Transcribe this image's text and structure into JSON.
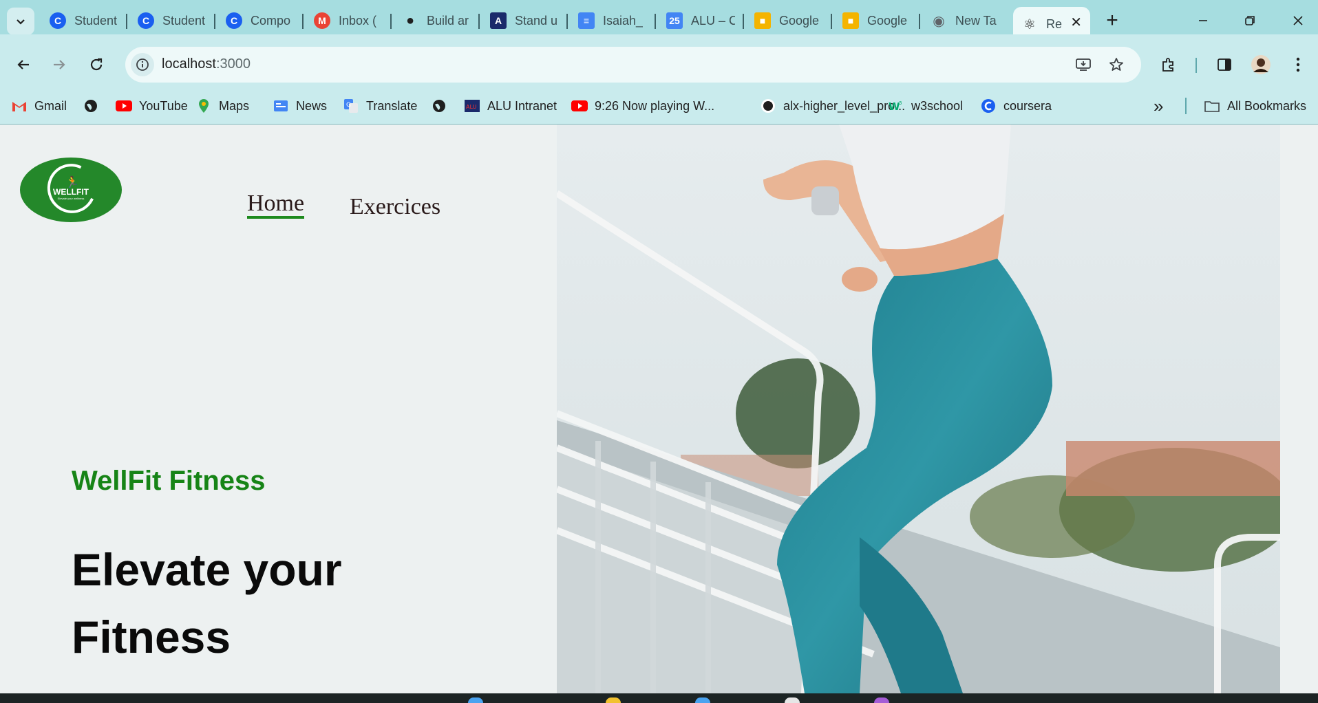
{
  "browser": {
    "tabs": [
      {
        "title": "Student",
        "icon": "c-logo-icon",
        "color": "#1a5ff0"
      },
      {
        "title": "Student",
        "icon": "c-logo-icon",
        "color": "#1a5ff0"
      },
      {
        "title": "Compo",
        "icon": "c-logo-icon",
        "color": "#1a5ff0"
      },
      {
        "title": "Inbox (",
        "icon": "gmail-icon",
        "color": "#ea4335"
      },
      {
        "title": "Build ar",
        "icon": "github-icon",
        "color": "#1f1f1f"
      },
      {
        "title": "Stand u",
        "icon": "alu-icon",
        "color": "#1b2a6b"
      },
      {
        "title": "Isaiah_",
        "icon": "docs-icon",
        "color": "#4285f4"
      },
      {
        "title": "ALU – C",
        "icon": "calendar-icon",
        "color": "#4285f4"
      },
      {
        "title": "Google",
        "icon": "slides-icon",
        "color": "#f4b400"
      },
      {
        "title": "Google",
        "icon": "slides-icon",
        "color": "#f4b400"
      },
      {
        "title": "New Ta",
        "icon": "chrome-icon",
        "color": "#5f6368"
      },
      {
        "title": "Re",
        "icon": "react-icon",
        "color": "#222222",
        "active": true
      }
    ],
    "new_tab_label": "+",
    "url": {
      "host": "localhost",
      "port": ":3000"
    },
    "bookmarks": [
      {
        "label": "Gmail",
        "icon": "gmail-icon"
      },
      {
        "label": "",
        "icon": "globe-icon"
      },
      {
        "label": "YouTube",
        "icon": "youtube-icon"
      },
      {
        "label": "Maps",
        "icon": "maps-icon"
      },
      {
        "label": "News",
        "icon": "news-icon"
      },
      {
        "label": "Translate",
        "icon": "translate-icon"
      },
      {
        "label": "",
        "icon": "globe-icon"
      },
      {
        "label": "ALU Intranet",
        "icon": "alu-icon"
      },
      {
        "label": "9:26 Now playing W...",
        "icon": "youtube-icon"
      },
      {
        "label": "alx-higher_level_pro...",
        "icon": "github-icon"
      },
      {
        "label": "w3school",
        "icon": "w3-icon"
      },
      {
        "label": "coursera",
        "icon": "c-logo-icon"
      }
    ],
    "all_bookmarks_label": "All Bookmarks",
    "overflow_label": "»"
  },
  "site": {
    "logo": {
      "text": "WELLFIT",
      "subtext": "Elevate your wellness"
    },
    "nav": [
      {
        "label": "Home",
        "active": true
      },
      {
        "label": "Exercices",
        "active": false
      }
    ],
    "brand": "WellFit Fitness",
    "headline": "Elevate your Fitness"
  },
  "colors": {
    "accent_green": "#168416",
    "logo_green": "#24882a",
    "tabbar": "#a6dde0",
    "leggings_teal": "#2a8c9c"
  }
}
